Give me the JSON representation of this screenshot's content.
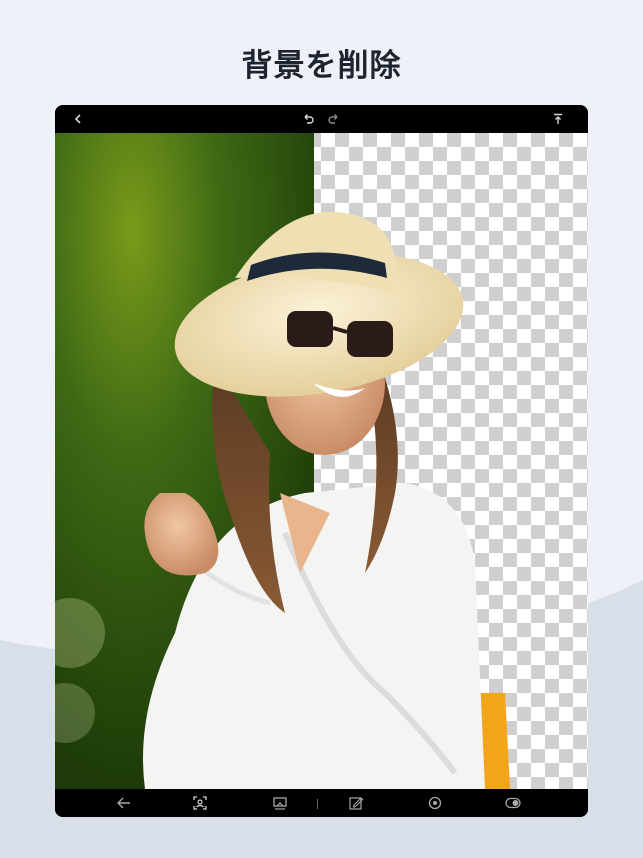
{
  "page": {
    "headline": "背景を削除"
  },
  "colors": {
    "page_background": "#eef2f8",
    "device_frame": "#000000",
    "icon_color": "#d8d8d8",
    "transparent_grid_dark": "#cfcfcf",
    "transparent_grid_light": "#ffffff",
    "background_green": "#2f5a12"
  },
  "toolbar_top": {
    "icons": [
      "back-chevron-icon",
      "undo-icon",
      "redo-icon",
      "export-icon"
    ]
  },
  "toolbar_bottom": {
    "icons": [
      "back-arrow-icon",
      "auto-select-icon",
      "background-icon",
      "edit-pencil-icon",
      "focus-target-icon",
      "toggle-compare-icon"
    ]
  }
}
